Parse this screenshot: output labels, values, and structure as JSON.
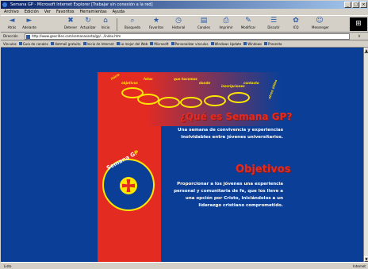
{
  "window": {
    "title": "Semana GP - Microsoft Internet Explorer [Trabajar sin conexión a la red]",
    "buttons": {
      "minimize": "_",
      "maximize": "□",
      "close": "×"
    }
  },
  "menu": [
    "Archivo",
    "Edición",
    "Ver",
    "Favoritos",
    "Herramientas",
    "Ayuda"
  ],
  "toolbar": [
    {
      "label": "Atrás",
      "icon": "back-arrow-icon",
      "glyph": "◄"
    },
    {
      "label": "Adelante",
      "icon": "forward-arrow-icon",
      "glyph": "►"
    },
    {
      "label": "Detener",
      "icon": "stop-icon",
      "glyph": "✖"
    },
    {
      "label": "Actualizar",
      "icon": "refresh-icon",
      "glyph": "↻"
    },
    {
      "label": "Inicio",
      "icon": "home-icon",
      "glyph": "⌂"
    },
    {
      "label": "Búsqueda",
      "icon": "search-icon",
      "glyph": "⌕"
    },
    {
      "label": "Favoritos",
      "icon": "favorites-icon",
      "glyph": "★"
    },
    {
      "label": "Historial",
      "icon": "history-icon",
      "glyph": "◷"
    },
    {
      "label": "Canales",
      "icon": "channels-icon",
      "glyph": "▤"
    },
    {
      "label": "Imprimir",
      "icon": "print-icon",
      "glyph": "⎙"
    },
    {
      "label": "Modificar",
      "icon": "edit-icon",
      "glyph": "✎"
    },
    {
      "label": "Discutir",
      "icon": "discuss-icon",
      "glyph": "☰"
    },
    {
      "label": "ICQ",
      "icon": "icq-icon",
      "glyph": "✿"
    },
    {
      "label": "Messenger",
      "icon": "messenger-icon",
      "glyph": "☺"
    }
  ],
  "address": {
    "label": "Dirección",
    "value": "http://www.geocities.com/semanasanta/gp/.../index.htm",
    "go_label": "Ir"
  },
  "links": {
    "label": "Vínculos",
    "items": [
      "Guía de canales",
      "Hotmail gratuito",
      "Inicio de Internet",
      "Lo mejor del Web",
      "Microsoft",
      "Personalizar vínculos",
      "Windows Update",
      "Windows",
      "Presenta"
    ]
  },
  "page": {
    "nav_links": [
      "inicio",
      "objetivos",
      "fotos",
      "que hacemos",
      "donde",
      "inscripciones",
      "contacto",
      "otros sitios"
    ],
    "logo": {
      "text_white": "Semana G",
      "text_yellow": "P"
    },
    "heading_1": "¿Qué es Semana GP?",
    "paragraph_1": "Una semana de convivencia y experiencias inolvidables entre jóvenes universitarios.",
    "heading_2": "Objetivos",
    "paragraph_2": "Proporcionar a los jóvenes una experiencia personal y comunitaria de fe, que los lleve a una opción por Cristo, iniciándolos a un liderazgo cristiano comprometido."
  },
  "status": {
    "left": "Listo",
    "zone": "Internet"
  },
  "colors": {
    "page_bg": "#0b3f97",
    "accent_red": "#e42b22",
    "accent_yellow": "#ffe600",
    "chrome": "#d4d0c8",
    "title_bar": "#0a246a"
  }
}
